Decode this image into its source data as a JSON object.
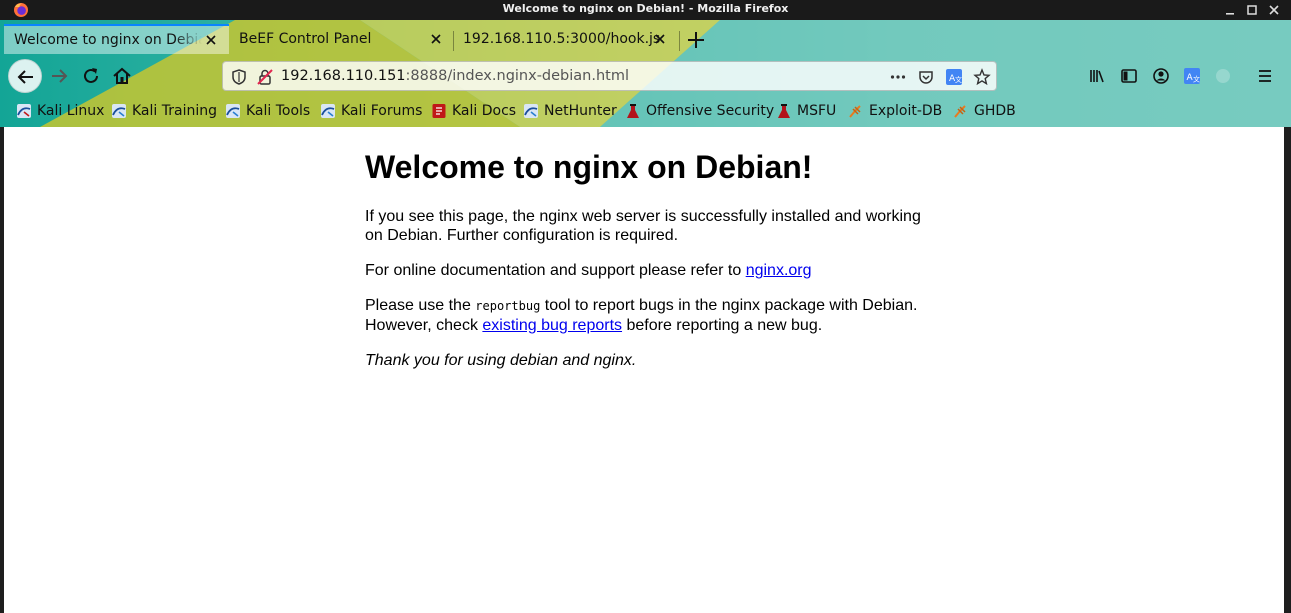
{
  "window": {
    "title": "Welcome to nginx on Debian! - Mozilla Firefox"
  },
  "tabs": [
    {
      "label": "Welcome to nginx on Debian!",
      "active": true
    },
    {
      "label": "BeEF Control Panel",
      "active": false
    },
    {
      "label": "192.168.110.5:3000/hook.js",
      "active": false
    }
  ],
  "urlbar": {
    "host": "192.168.110.151",
    "rest": ":8888/index.nginx-debian.html"
  },
  "bookmarks": [
    {
      "label": "Kali Linux",
      "icon": "kali-icon"
    },
    {
      "label": "Kali Training",
      "icon": "kali-training-icon"
    },
    {
      "label": "Kali Tools",
      "icon": "kali-tools-icon"
    },
    {
      "label": "Kali Forums",
      "icon": "kali-forums-icon"
    },
    {
      "label": "Kali Docs",
      "icon": "kali-docs-icon"
    },
    {
      "label": "NetHunter",
      "icon": "nethunter-icon"
    },
    {
      "label": "Offensive Security",
      "icon": "offsec-icon"
    },
    {
      "label": "MSFU",
      "icon": "msfu-icon"
    },
    {
      "label": "Exploit-DB",
      "icon": "exploitdb-icon"
    },
    {
      "label": "GHDB",
      "icon": "ghdb-icon"
    }
  ],
  "page": {
    "heading": "Welcome to nginx on Debian!",
    "p1": "If you see this page, the nginx web server is successfully installed and working on Debian. Further configuration is required.",
    "p2_text": "For online documentation and support please refer to ",
    "p2_link": "nginx.org",
    "p3_before": "Please use the ",
    "p3_code": "reportbug",
    "p3_middle": " tool to report bugs in the nginx package with Debian. However, check ",
    "p3_link": "existing bug reports",
    "p3_after": " before reporting a new bug.",
    "p4": "Thank you for using debian and nginx."
  },
  "colors": {
    "theme_teal": "#13a596",
    "theme_yellow": "#d6c82a",
    "link": "#0000ee",
    "tab_accent": "#0a84ff"
  }
}
